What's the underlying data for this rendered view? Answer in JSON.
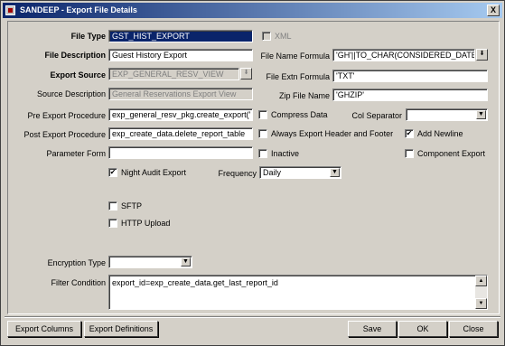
{
  "window": {
    "title": "SANDEEP - Export File Details",
    "close_glyph": "X"
  },
  "fields": {
    "file_type": {
      "label": "File Type",
      "value": "GST_HIST_EXPORT"
    },
    "xml": {
      "label": "XML",
      "checked": false
    },
    "file_description": {
      "label": "File Description",
      "value": "Guest History Export"
    },
    "file_name_formula": {
      "label": "File Name Formula",
      "value": "'GH'||TO_CHAR(CONSIDERED_DATE"
    },
    "export_source": {
      "label": "Export Source",
      "value": "EXP_GENERAL_RESV_VIEW"
    },
    "file_extn_formula": {
      "label": "File Extn Formula",
      "value": "'TXT'"
    },
    "source_description": {
      "label": "Source Description",
      "value": "General Reservations Export View"
    },
    "zip_file_name": {
      "label": "Zip File Name",
      "value": "'GHZIP'"
    },
    "pre_export_procedure": {
      "label": "Pre Export Procedure",
      "value": "exp_general_resv_pkg.create_export('"
    },
    "compress_data": {
      "label": "Compress Data",
      "checked": false
    },
    "col_separator": {
      "label": "Col Separator",
      "value": ""
    },
    "post_export_procedure": {
      "label": "Post Export Procedure",
      "value": "exp_create_data.delete_report_table"
    },
    "always_export_header": {
      "label": "Always Export Header and Footer",
      "checked": false
    },
    "add_newline": {
      "label": "Add Newline",
      "checked": true
    },
    "parameter_form": {
      "label": "Parameter Form",
      "value": ""
    },
    "inactive": {
      "label": "Inactive",
      "checked": false
    },
    "component_export": {
      "label": "Component Export",
      "checked": false
    },
    "night_audit_export": {
      "label": "Night Audit Export",
      "checked": true
    },
    "frequency": {
      "label": "Frequency",
      "value": "Daily"
    },
    "sftp": {
      "label": "SFTP",
      "checked": false
    },
    "http_upload": {
      "label": "HTTP Upload",
      "checked": false
    },
    "encryption_type": {
      "label": "Encryption Type",
      "value": ""
    },
    "filter_condition": {
      "label": "Filter Condition",
      "value": "export_id=exp_create_data.get_last_report_id"
    }
  },
  "buttons": {
    "export_columns": "Export Columns",
    "export_definitions": "Export Definitions",
    "save": "Save",
    "ok": "OK",
    "close": "Close"
  },
  "glyphs": {
    "check": "✔",
    "dropdown": "▼",
    "lov": "⬇",
    "up": "▲",
    "down": "▼"
  }
}
